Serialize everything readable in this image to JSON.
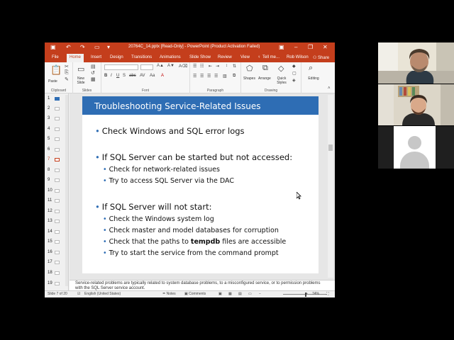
{
  "window": {
    "title": "20764C_14.pptx [Read-Only] - PowerPoint (Product Activation Failed)",
    "user": "Rob Wilson",
    "share": "Share",
    "tell_me": "Tell me..."
  },
  "tabs": [
    "File",
    "Home",
    "Insert",
    "Design",
    "Transitions",
    "Animations",
    "Slide Show",
    "Review",
    "View"
  ],
  "active_tab": "Home",
  "ribbon": {
    "groups": [
      "Clipboard",
      "Slides",
      "Font",
      "Paragraph",
      "Drawing"
    ],
    "paste": "Paste",
    "new_slide": "New Slide",
    "shapes": "Shapes",
    "arrange": "Arrange",
    "quick_styles": "Quick Styles",
    "editing": "Editing"
  },
  "thumbnails": [
    "1",
    "2",
    "3",
    "4",
    "5",
    "6",
    "7",
    "8",
    "9",
    "10",
    "11",
    "12",
    "13",
    "14",
    "15",
    "16",
    "17",
    "18",
    "19"
  ],
  "selected_thumbnail": "7",
  "slide": {
    "title": "Troubleshooting Service-Related Issues",
    "bullets": [
      "Check Windows and SQL error logs",
      "If SQL Server can be started but not accessed:",
      "Check for network-related issues",
      "Try to access SQL Server via the DAC",
      "If SQL Server will not start:",
      "Check the Windows system log",
      "Check master and model databases for corruption",
      "Check that the paths to ",
      "tempdb",
      " files are accessible",
      "Try to start the service from the command prompt"
    ]
  },
  "notes": "Service-related problems are typically related to system database problems, to a misconfigured service, or to permission problems with the SQL Server service account.",
  "status": {
    "slide_count": "Slide 7 of 20",
    "language": "English (United States)",
    "notes": "Notes",
    "comments": "Comments",
    "zoom": "74%"
  },
  "colors": {
    "accent": "#c43e1c",
    "slide_title_bar": "#2e6db4"
  }
}
